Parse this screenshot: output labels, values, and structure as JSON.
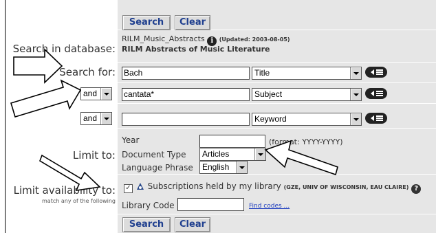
{
  "buttons": {
    "search": "Search",
    "clear": "Clear"
  },
  "labels": {
    "search_in_database": "Search in database:",
    "search_for": "Search for:",
    "limit_to": "Limit to:",
    "limit_availability_to": "Limit availability to:",
    "match_any": "match any of the following"
  },
  "database": {
    "name": "RILM_Music_Abstracts",
    "updated": "(Updated: 2003-08-05)",
    "full_name": "RILM Abstracts of Music Literature"
  },
  "search_rows": [
    {
      "term": "Bach",
      "field": "Title"
    },
    {
      "operator": "and",
      "term": "cantata*",
      "field": "Subject"
    },
    {
      "operator": "and",
      "term": "",
      "field": "Keyword"
    }
  ],
  "limits": {
    "year_label": "Year",
    "year_value": "",
    "year_format": "(format: YYYY-YYYY)",
    "doctype_label": "Document Type",
    "doctype_value": "Articles",
    "language_label": "Language Phrase",
    "language_value": "English"
  },
  "availability": {
    "subscriptions_label": "Subscriptions held by my library",
    "library_note": "(GZE, UNIV OF WISCONSIN, EAU CLAIRE)",
    "library_code_label": "Library Code",
    "library_code_value": "",
    "find_codes": "Find codes ..."
  },
  "colors": {
    "panel": "#e6e6e6",
    "button_text": "#1f3f8f",
    "link": "#1f3fbf"
  },
  "icons": [
    "info-icon",
    "history-icon",
    "subscriptions-icon",
    "help-icon"
  ]
}
